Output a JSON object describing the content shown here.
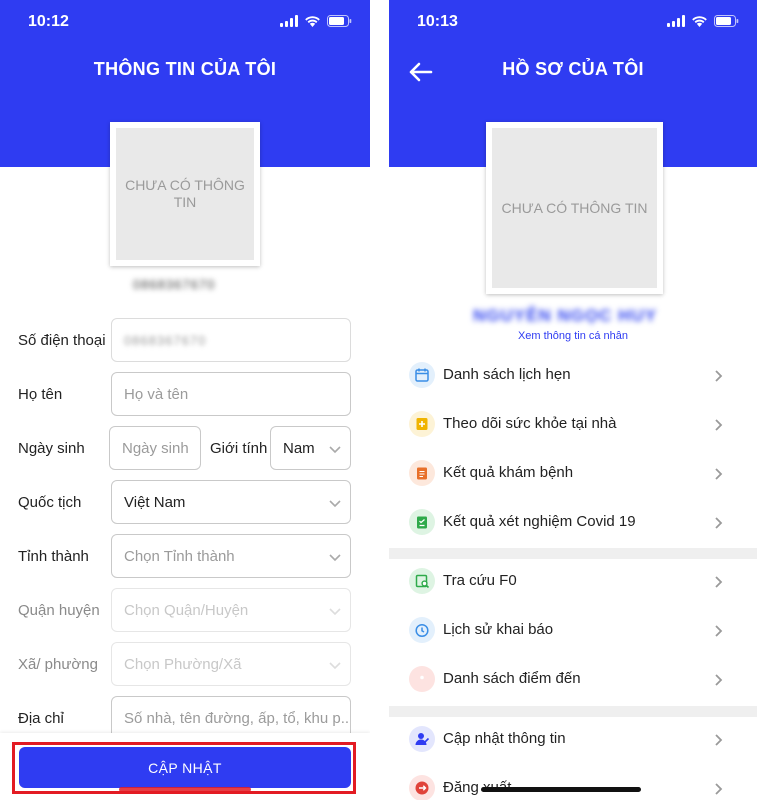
{
  "left": {
    "status_time": "10:12",
    "title": "THÔNG TIN CỦA TÔI",
    "avatar_text": "CHƯA CÓ THÔNG TIN",
    "phone_blurred": "0868367670",
    "form": {
      "phone": {
        "label": "Số điện thoại",
        "value": "0868367670"
      },
      "name": {
        "label": "Họ tên",
        "placeholder": "Họ và tên"
      },
      "dob": {
        "label": "Ngày sinh",
        "placeholder": "Ngày sinh"
      },
      "gender": {
        "label": "Giới tính",
        "value": "Nam"
      },
      "nationality": {
        "label": "Quốc tịch",
        "value": "Việt Nam"
      },
      "province": {
        "label": "Tỉnh thành",
        "placeholder": "Chọn Tỉnh thành"
      },
      "district": {
        "label": "Quận huyện",
        "placeholder": "Chọn Quận/Huyện"
      },
      "ward": {
        "label": "Xã/ phường",
        "placeholder": "Chọn Phường/Xã"
      },
      "address": {
        "label": "Địa chỉ",
        "placeholder": "Số nhà, tên đường, ấp, tổ, khu p..."
      }
    },
    "update_button": "CẬP NHẬT"
  },
  "right": {
    "status_time": "10:13",
    "title": "HỒ SƠ CỦA TÔI",
    "avatar_text": "CHƯA CÓ THÔNG TIN",
    "name_blurred": "NGUYỄN NGỌC HUY",
    "view_info_link": "Xem thông tin cá nhân",
    "menu": [
      {
        "label": "Danh sách lịch hẹn",
        "icon": "calendar-icon",
        "color": "#3a8ee6",
        "bg": "#e3f0fc"
      },
      {
        "label": "Theo dõi sức khỏe tại nhà",
        "icon": "health-icon",
        "color": "#f0b400",
        "bg": "#fdf3d6"
      },
      {
        "label": "Kết quả khám bệnh",
        "icon": "clipboard-icon",
        "color": "#e8702a",
        "bg": "#fde8dc"
      },
      {
        "label": "Kết quả xét nghiệm Covid 19",
        "icon": "test-result-icon",
        "color": "#2eaa4a",
        "bg": "#def4e3"
      },
      {
        "label": "Tra cứu F0",
        "icon": "lookup-icon",
        "color": "#2eaa4a",
        "bg": "#def4e3"
      },
      {
        "label": "Lịch sử khai báo",
        "icon": "history-icon",
        "color": "#3a8ee6",
        "bg": "#e3f0fc"
      },
      {
        "label": "Danh sách điểm đến",
        "icon": "location-pin-icon",
        "color": "#e0433a",
        "bg": "#fde3e1"
      },
      {
        "label": "Cập nhật thông tin",
        "icon": "user-edit-icon",
        "color": "#2f3cf2",
        "bg": "#e3e6fd"
      },
      {
        "label": "Đăng xuất",
        "icon": "logout-icon",
        "color": "#e0433a",
        "bg": "#fde3e1"
      }
    ]
  },
  "colors": {
    "brand_blue": "#2f3cf2",
    "highlight_red": "#e31b23"
  }
}
